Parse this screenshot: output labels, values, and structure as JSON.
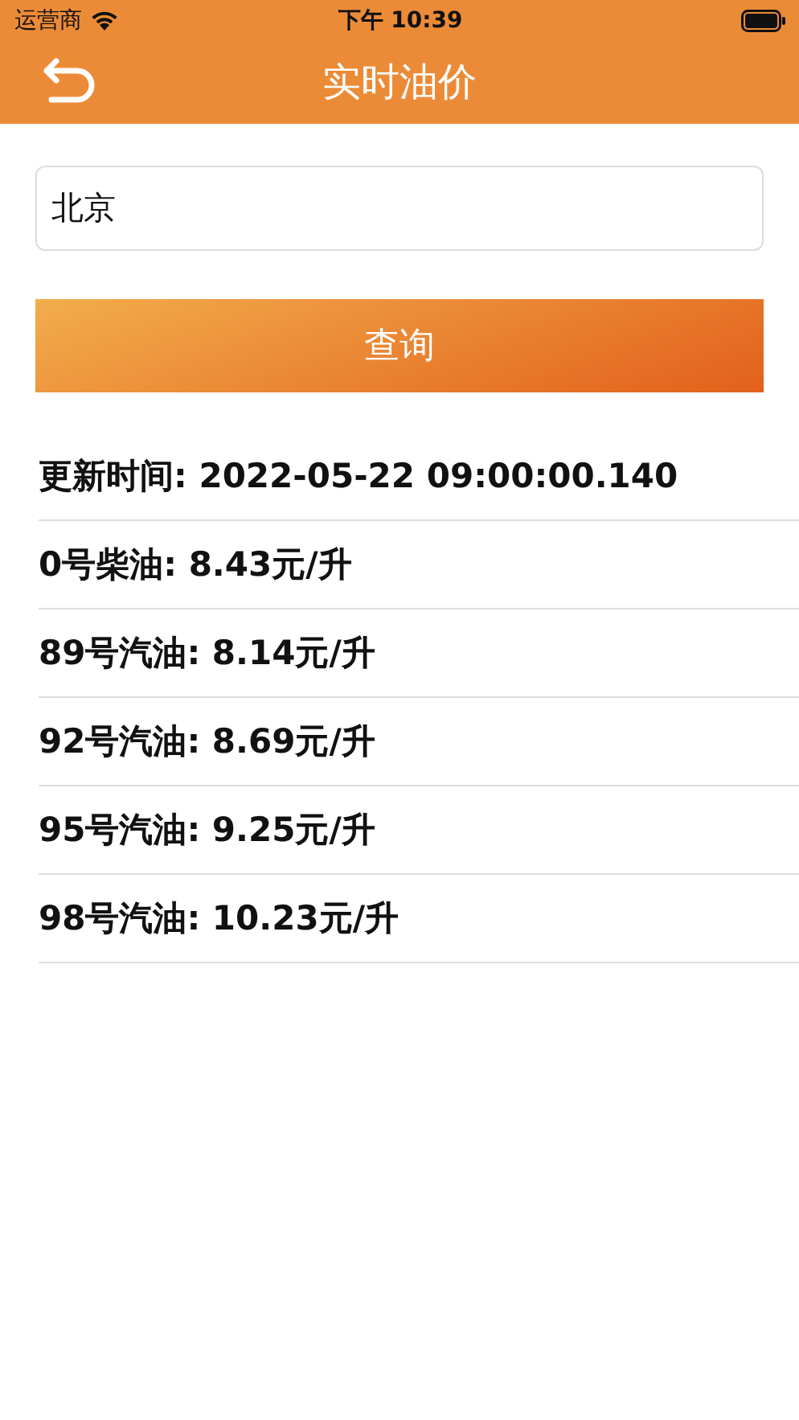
{
  "status_bar": {
    "carrier": "运营商",
    "time": "下午 10:39"
  },
  "header": {
    "title": "实时油价"
  },
  "city_field": {
    "value": "北京"
  },
  "query_button": {
    "label": "查询"
  },
  "price_list": [
    {
      "text": "更新时间: 2022-05-22 09:00:00.140"
    },
    {
      "text": "0号柴油: 8.43元/升"
    },
    {
      "text": "89号汽油: 8.14元/升"
    },
    {
      "text": "92号汽油: 8.69元/升"
    },
    {
      "text": "95号汽油: 9.25元/升"
    },
    {
      "text": "98号汽油: 10.23元/升"
    }
  ]
}
